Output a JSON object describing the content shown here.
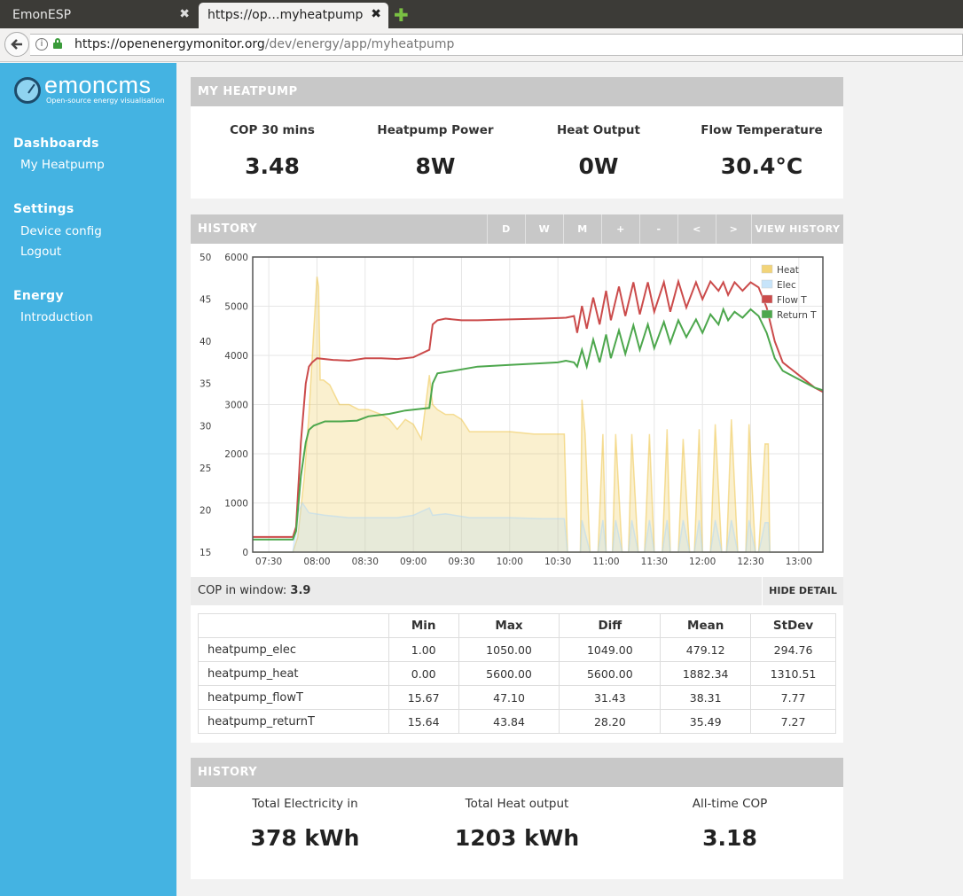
{
  "browser": {
    "tabs": [
      {
        "label": "EmonESP",
        "close": "✖"
      },
      {
        "label": "https://op…myheatpump",
        "close": "✖"
      }
    ],
    "new_tab": "✚",
    "back": "🡐",
    "url_host": "https://openenergymonitor.org",
    "url_path": "/dev/energy/app/myheatpump",
    "info_icon": "i"
  },
  "sidebar": {
    "logo_word": "emoncms",
    "logo_tag": "Open-source energy visualisation",
    "sections": [
      {
        "heading": "Dashboards",
        "items": [
          "My Heatpump"
        ]
      },
      {
        "heading": "Settings",
        "items": [
          "Device config",
          "Logout"
        ]
      },
      {
        "heading": "Energy",
        "items": [
          "Introduction"
        ]
      }
    ]
  },
  "my_heatpump": {
    "title": "MY HEATPUMP",
    "stats": [
      {
        "label": "COP 30 mins",
        "value": "3.48"
      },
      {
        "label": "Heatpump Power",
        "value": "8W"
      },
      {
        "label": "Heat Output",
        "value": "0W"
      },
      {
        "label": "Flow Temperature",
        "value": "30.4°C"
      }
    ]
  },
  "history_panel": {
    "title": "HISTORY",
    "buttons": [
      "D",
      "W",
      "M",
      "+",
      "-",
      "<",
      ">",
      "VIEW HISTORY"
    ]
  },
  "cop_window": {
    "label": "COP in window:",
    "value": "3.9",
    "hide_detail": "HIDE DETAIL"
  },
  "stats_table": {
    "headers": [
      "",
      "Min",
      "Max",
      "Diff",
      "Mean",
      "StDev"
    ],
    "rows": [
      [
        "heatpump_elec",
        "1.00",
        "1050.00",
        "1049.00",
        "479.12",
        "294.76"
      ],
      [
        "heatpump_heat",
        "0.00",
        "5600.00",
        "5600.00",
        "1882.34",
        "1310.51"
      ],
      [
        "heatpump_flowT",
        "15.67",
        "47.10",
        "31.43",
        "38.31",
        "7.77"
      ],
      [
        "heatpump_returnT",
        "15.64",
        "43.84",
        "28.20",
        "35.49",
        "7.27"
      ]
    ]
  },
  "history_totals": {
    "title": "HISTORY",
    "stats": [
      {
        "label": "Total Electricity in",
        "value": "378 kWh"
      },
      {
        "label": "Total Heat output",
        "value": "1203 kWh"
      },
      {
        "label": "All-time COP",
        "value": "3.18"
      }
    ]
  },
  "colors": {
    "sidebar": "#44b3e2",
    "heat": "#edc240",
    "elec": "#afd8f8",
    "flowT": "#cb4b4b",
    "returnT": "#4da74d"
  },
  "chart_data": {
    "type": "area",
    "x_labels": [
      "07:30",
      "08:00",
      "08:30",
      "09:00",
      "09:30",
      "10:00",
      "10:30",
      "11:00",
      "11:30",
      "12:00",
      "12:30",
      "13:00"
    ],
    "y_left_ticks": [
      15,
      20,
      25,
      30,
      35,
      40,
      45,
      50
    ],
    "y_right_ticks": [
      0,
      1000,
      2000,
      3000,
      4000,
      5000,
      6000
    ],
    "y_left_range": [
      15,
      50
    ],
    "y_right_range": [
      0,
      6000
    ],
    "x_range": [
      "07:20",
      "13:15"
    ],
    "legend": [
      "Heat",
      "Elec",
      "Flow T",
      "Return T"
    ],
    "legend_position": "top-right",
    "grid": true,
    "series": [
      {
        "name": "Heat",
        "axis": "right",
        "points": [
          [
            "07:20",
            0
          ],
          [
            "07:45",
            0
          ],
          [
            "07:48",
            300
          ],
          [
            "07:52",
            1500
          ],
          [
            "07:55",
            2800
          ],
          [
            "07:58",
            4500
          ],
          [
            "08:00",
            5600
          ],
          [
            "08:01",
            5400
          ],
          [
            "08:02",
            3500
          ],
          [
            "08:04",
            3500
          ],
          [
            "08:08",
            3400
          ],
          [
            "08:14",
            3000
          ],
          [
            "08:20",
            3000
          ],
          [
            "08:26",
            2900
          ],
          [
            "08:32",
            2900
          ],
          [
            "08:40",
            2800
          ],
          [
            "08:45",
            2700
          ],
          [
            "08:50",
            2500
          ],
          [
            "08:55",
            2700
          ],
          [
            "09:00",
            2600
          ],
          [
            "09:05",
            2300
          ],
          [
            "09:10",
            3600
          ],
          [
            "09:12",
            3000
          ],
          [
            "09:15",
            2900
          ],
          [
            "09:20",
            2800
          ],
          [
            "09:25",
            2800
          ],
          [
            "09:30",
            2700
          ],
          [
            "09:35",
            2450
          ],
          [
            "09:45",
            2450
          ],
          [
            "10:00",
            2450
          ],
          [
            "10:15",
            2400
          ],
          [
            "10:30",
            2400
          ],
          [
            "10:34",
            2400
          ],
          [
            "10:36",
            0
          ],
          [
            "10:44",
            0
          ],
          [
            "10:45",
            3100
          ],
          [
            "10:47",
            2400
          ],
          [
            "10:50",
            0
          ],
          [
            "10:55",
            0
          ],
          [
            "10:58",
            2400
          ],
          [
            "11:00",
            0
          ],
          [
            "11:04",
            0
          ],
          [
            "11:06",
            2400
          ],
          [
            "11:10",
            0
          ],
          [
            "11:14",
            0
          ],
          [
            "11:16",
            2400
          ],
          [
            "11:20",
            0
          ],
          [
            "11:24",
            0
          ],
          [
            "11:27",
            2400
          ],
          [
            "11:30",
            0
          ],
          [
            "11:35",
            0
          ],
          [
            "11:38",
            2500
          ],
          [
            "11:40",
            0
          ],
          [
            "11:45",
            0
          ],
          [
            "11:48",
            2300
          ],
          [
            "11:52",
            0
          ],
          [
            "11:55",
            0
          ],
          [
            "11:58",
            2500
          ],
          [
            "12:00",
            0
          ],
          [
            "12:05",
            0
          ],
          [
            "12:08",
            2600
          ],
          [
            "12:12",
            0
          ],
          [
            "12:15",
            0
          ],
          [
            "12:18",
            2700
          ],
          [
            "12:22",
            0
          ],
          [
            "12:27",
            0
          ],
          [
            "12:29",
            2600
          ],
          [
            "12:33",
            0
          ],
          [
            "12:35",
            0
          ],
          [
            "12:39",
            2200
          ],
          [
            "12:41",
            2200
          ],
          [
            "12:42",
            0
          ],
          [
            "13:15",
            0
          ]
        ]
      },
      {
        "name": "Elec",
        "axis": "right",
        "points": [
          [
            "07:20",
            0
          ],
          [
            "07:45",
            0
          ],
          [
            "07:48",
            800
          ],
          [
            "07:51",
            1000
          ],
          [
            "07:55",
            800
          ],
          [
            "08:05",
            750
          ],
          [
            "08:20",
            700
          ],
          [
            "08:35",
            700
          ],
          [
            "08:50",
            700
          ],
          [
            "09:00",
            750
          ],
          [
            "09:10",
            900
          ],
          [
            "09:12",
            750
          ],
          [
            "09:20",
            780
          ],
          [
            "09:35",
            700
          ],
          [
            "10:00",
            700
          ],
          [
            "10:20",
            680
          ],
          [
            "10:34",
            680
          ],
          [
            "10:36",
            0
          ],
          [
            "10:44",
            0
          ],
          [
            "10:45",
            650
          ],
          [
            "10:50",
            0
          ],
          [
            "10:55",
            0
          ],
          [
            "10:58",
            650
          ],
          [
            "11:00",
            0
          ],
          [
            "11:04",
            0
          ],
          [
            "11:06",
            650
          ],
          [
            "11:10",
            0
          ],
          [
            "11:14",
            0
          ],
          [
            "11:16",
            650
          ],
          [
            "11:20",
            0
          ],
          [
            "11:24",
            0
          ],
          [
            "11:27",
            650
          ],
          [
            "11:30",
            0
          ],
          [
            "11:35",
            0
          ],
          [
            "11:38",
            650
          ],
          [
            "11:40",
            0
          ],
          [
            "11:45",
            0
          ],
          [
            "11:48",
            650
          ],
          [
            "11:52",
            0
          ],
          [
            "11:55",
            0
          ],
          [
            "11:58",
            650
          ],
          [
            "12:00",
            0
          ],
          [
            "12:05",
            0
          ],
          [
            "12:08",
            650
          ],
          [
            "12:12",
            0
          ],
          [
            "12:15",
            0
          ],
          [
            "12:18",
            650
          ],
          [
            "12:22",
            0
          ],
          [
            "12:27",
            0
          ],
          [
            "12:29",
            650
          ],
          [
            "12:33",
            0
          ],
          [
            "12:35",
            0
          ],
          [
            "12:39",
            600
          ],
          [
            "12:41",
            600
          ],
          [
            "12:42",
            0
          ],
          [
            "13:15",
            0
          ]
        ]
      },
      {
        "name": "Flow T",
        "axis": "left",
        "points": [
          [
            "07:20",
            16.8
          ],
          [
            "07:45",
            16.8
          ],
          [
            "07:47",
            18
          ],
          [
            "07:50",
            28
          ],
          [
            "07:53",
            35
          ],
          [
            "07:55",
            37
          ],
          [
            "07:57",
            37.5
          ],
          [
            "08:00",
            38
          ],
          [
            "08:10",
            37.8
          ],
          [
            "08:20",
            37.7
          ],
          [
            "08:30",
            38
          ],
          [
            "08:40",
            38
          ],
          [
            "08:50",
            37.9
          ],
          [
            "09:00",
            38.1
          ],
          [
            "09:10",
            39
          ],
          [
            "09:12",
            42
          ],
          [
            "09:15",
            42.5
          ],
          [
            "09:20",
            42.7
          ],
          [
            "09:30",
            42.5
          ],
          [
            "09:40",
            42.5
          ],
          [
            "10:00",
            42.6
          ],
          [
            "10:20",
            42.7
          ],
          [
            "10:35",
            42.8
          ],
          [
            "10:40",
            43
          ],
          [
            "10:42",
            41
          ],
          [
            "10:45",
            44.2
          ],
          [
            "10:48",
            41.5
          ],
          [
            "10:52",
            45.2
          ],
          [
            "10:56",
            42
          ],
          [
            "11:00",
            46
          ],
          [
            "11:03",
            42.5
          ],
          [
            "11:08",
            46.5
          ],
          [
            "11:12",
            43
          ],
          [
            "11:17",
            47
          ],
          [
            "11:21",
            43.2
          ],
          [
            "11:26",
            47
          ],
          [
            "11:30",
            43.5
          ],
          [
            "11:36",
            47
          ],
          [
            "11:40",
            43.5
          ],
          [
            "11:45",
            47.1
          ],
          [
            "11:50",
            44
          ],
          [
            "11:56",
            47
          ],
          [
            "12:00",
            45
          ],
          [
            "12:05",
            47.1
          ],
          [
            "12:10",
            46
          ],
          [
            "12:13",
            47
          ],
          [
            "12:16",
            45.5
          ],
          [
            "12:20",
            47
          ],
          [
            "12:25",
            46
          ],
          [
            "12:30",
            47
          ],
          [
            "12:35",
            46.4
          ],
          [
            "12:40",
            44
          ],
          [
            "12:45",
            40
          ],
          [
            "12:50",
            37.5
          ],
          [
            "13:00",
            36
          ],
          [
            "13:10",
            34.5
          ],
          [
            "13:15",
            34
          ]
        ]
      },
      {
        "name": "Return T",
        "axis": "left",
        "points": [
          [
            "07:20",
            16.5
          ],
          [
            "07:45",
            16.5
          ],
          [
            "07:47",
            17.5
          ],
          [
            "07:50",
            24
          ],
          [
            "07:53",
            28
          ],
          [
            "07:55",
            29.5
          ],
          [
            "07:58",
            30
          ],
          [
            "08:05",
            30.5
          ],
          [
            "08:15",
            30.5
          ],
          [
            "08:25",
            30.6
          ],
          [
            "08:32",
            31.1
          ],
          [
            "08:45",
            31.4
          ],
          [
            "08:55",
            31.8
          ],
          [
            "09:05",
            32
          ],
          [
            "09:10",
            32.1
          ],
          [
            "09:12",
            35
          ],
          [
            "09:15",
            36.2
          ],
          [
            "09:25",
            36.5
          ],
          [
            "09:40",
            37
          ],
          [
            "10:00",
            37.2
          ],
          [
            "10:20",
            37.4
          ],
          [
            "10:30",
            37.5
          ],
          [
            "10:35",
            37.7
          ],
          [
            "10:40",
            37.5
          ],
          [
            "10:42",
            37
          ],
          [
            "10:45",
            39
          ],
          [
            "10:48",
            37
          ],
          [
            "10:52",
            40.2
          ],
          [
            "10:56",
            37.5
          ],
          [
            "11:00",
            40.8
          ],
          [
            "11:03",
            38
          ],
          [
            "11:08",
            41.3
          ],
          [
            "11:12",
            38.5
          ],
          [
            "11:17",
            41.9
          ],
          [
            "11:21",
            39
          ],
          [
            "11:26",
            42
          ],
          [
            "11:30",
            39.2
          ],
          [
            "11:36",
            42.3
          ],
          [
            "11:40",
            39.8
          ],
          [
            "11:45",
            42.5
          ],
          [
            "11:50",
            40.5
          ],
          [
            "11:56",
            42.6
          ],
          [
            "12:00",
            41
          ],
          [
            "12:05",
            43.2
          ],
          [
            "12:10",
            42
          ],
          [
            "12:13",
            43.8
          ],
          [
            "12:16",
            42.5
          ],
          [
            "12:20",
            43.5
          ],
          [
            "12:25",
            42.8
          ],
          [
            "12:30",
            43.8
          ],
          [
            "12:35",
            43
          ],
          [
            "12:40",
            41
          ],
          [
            "12:45",
            38
          ],
          [
            "12:50",
            36.5
          ],
          [
            "13:00",
            35.5
          ],
          [
            "13:10",
            34.5
          ],
          [
            "13:15",
            34.2
          ]
        ]
      }
    ]
  }
}
